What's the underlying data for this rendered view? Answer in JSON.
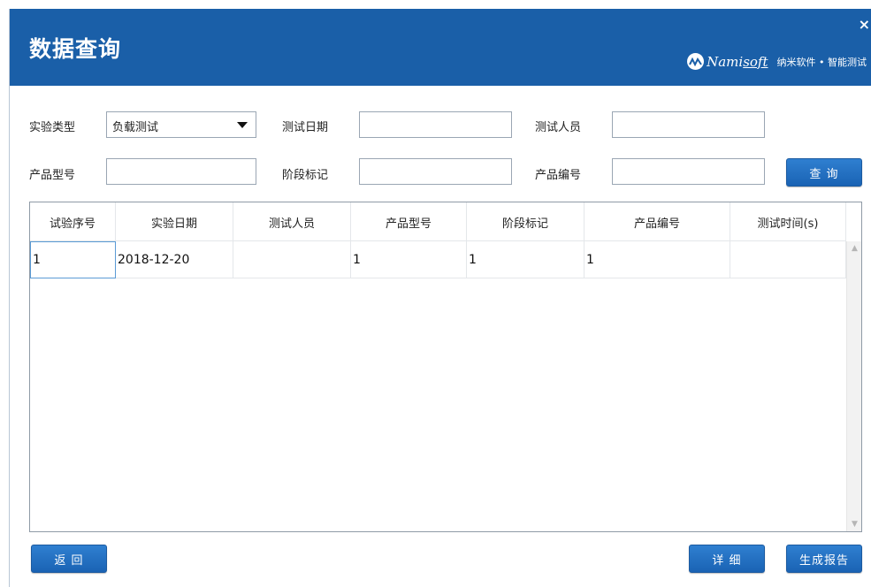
{
  "window": {
    "title": "数据查询",
    "close_glyph": "×"
  },
  "brand": {
    "name_prefix": "Nami",
    "name_suffix": "soft",
    "tagline": "纳米软件 • 智能测试"
  },
  "filters": {
    "test_type": {
      "label": "实验类型",
      "value": "负载测试"
    },
    "test_date": {
      "label": "测试日期",
      "value": ""
    },
    "tester": {
      "label": "测试人员",
      "value": ""
    },
    "product_model": {
      "label": "产品型号",
      "value": ""
    },
    "stage_mark": {
      "label": "阶段标记",
      "value": ""
    },
    "product_no": {
      "label": "产品编号",
      "value": ""
    }
  },
  "buttons": {
    "query": "查 询",
    "back": "返 回",
    "detail": "详 细",
    "report": "生成报告"
  },
  "table": {
    "columns": [
      "试验序号",
      "实验日期",
      "测试人员",
      "产品型号",
      "阶段标记",
      "产品编号",
      "测试时间(s)"
    ],
    "rows": [
      [
        "1",
        "2018-12-20",
        "",
        "1",
        "1",
        "1",
        ""
      ]
    ]
  },
  "colors": {
    "header_bg": "#1a5fa8",
    "button_bg": "#2470c2"
  },
  "icons": {
    "close": "close-icon",
    "dropdown": "dropdown-arrow-icon",
    "logo": "namisoft-logo-icon"
  }
}
